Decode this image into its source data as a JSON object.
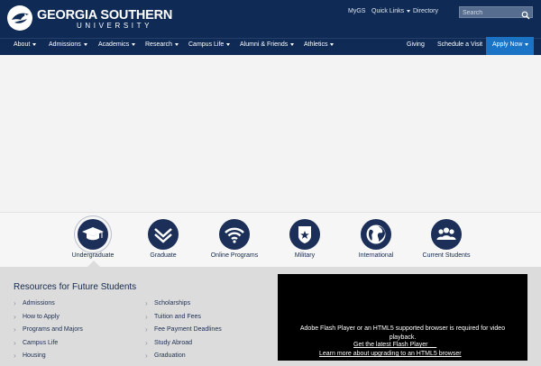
{
  "brand": {
    "name": "GEORGIA SOUTHERN",
    "sub": "UNIVERSITY"
  },
  "utility_nav": {
    "mygs": "MyGS",
    "quick_links": "Quick Links",
    "directory": "Directory"
  },
  "search": {
    "placeholder": "Search"
  },
  "main_nav": [
    {
      "label": "About"
    },
    {
      "label": "Admissions"
    },
    {
      "label": "Academics"
    },
    {
      "label": "Research"
    },
    {
      "label": "Campus Life"
    },
    {
      "label": "Alumni & Friends"
    },
    {
      "label": "Athletics"
    }
  ],
  "secondary_nav": {
    "giving": "Giving",
    "visit": "Schedule a Visit",
    "apply": "Apply Now"
  },
  "audience_tabs": [
    {
      "label": "Undergraduate",
      "icon": "graduation-cap-icon",
      "active": true
    },
    {
      "label": "Graduate",
      "icon": "chevron-badge-icon",
      "active": false
    },
    {
      "label": "Online Programs",
      "icon": "wifi-icon",
      "active": false
    },
    {
      "label": "Military",
      "icon": "military-shield-icon",
      "active": false
    },
    {
      "label": "International",
      "icon": "globe-icon",
      "active": false
    },
    {
      "label": "Current Students",
      "icon": "people-icon",
      "active": false
    }
  ],
  "resources": {
    "title": "Resources for Future Students",
    "col1": [
      "Admissions",
      "How to Apply",
      "Programs and Majors",
      "Campus Life",
      "Housing"
    ],
    "col2": [
      "Scholarships",
      "Tuition and Fees",
      "Fee Payment Deadlines",
      "Study Abroad",
      "Graduation"
    ]
  },
  "video": {
    "message": "Adobe Flash Player or an HTML5 supported browser is required for video playback.",
    "link1": "Get the latest Flash Player     ",
    "link2": "Learn more about upgrading to an HTML5 browser"
  },
  "colors": {
    "navy": "#0f2a55",
    "apply_blue": "#1a73c4",
    "icon_navy": "#1b2f58"
  }
}
